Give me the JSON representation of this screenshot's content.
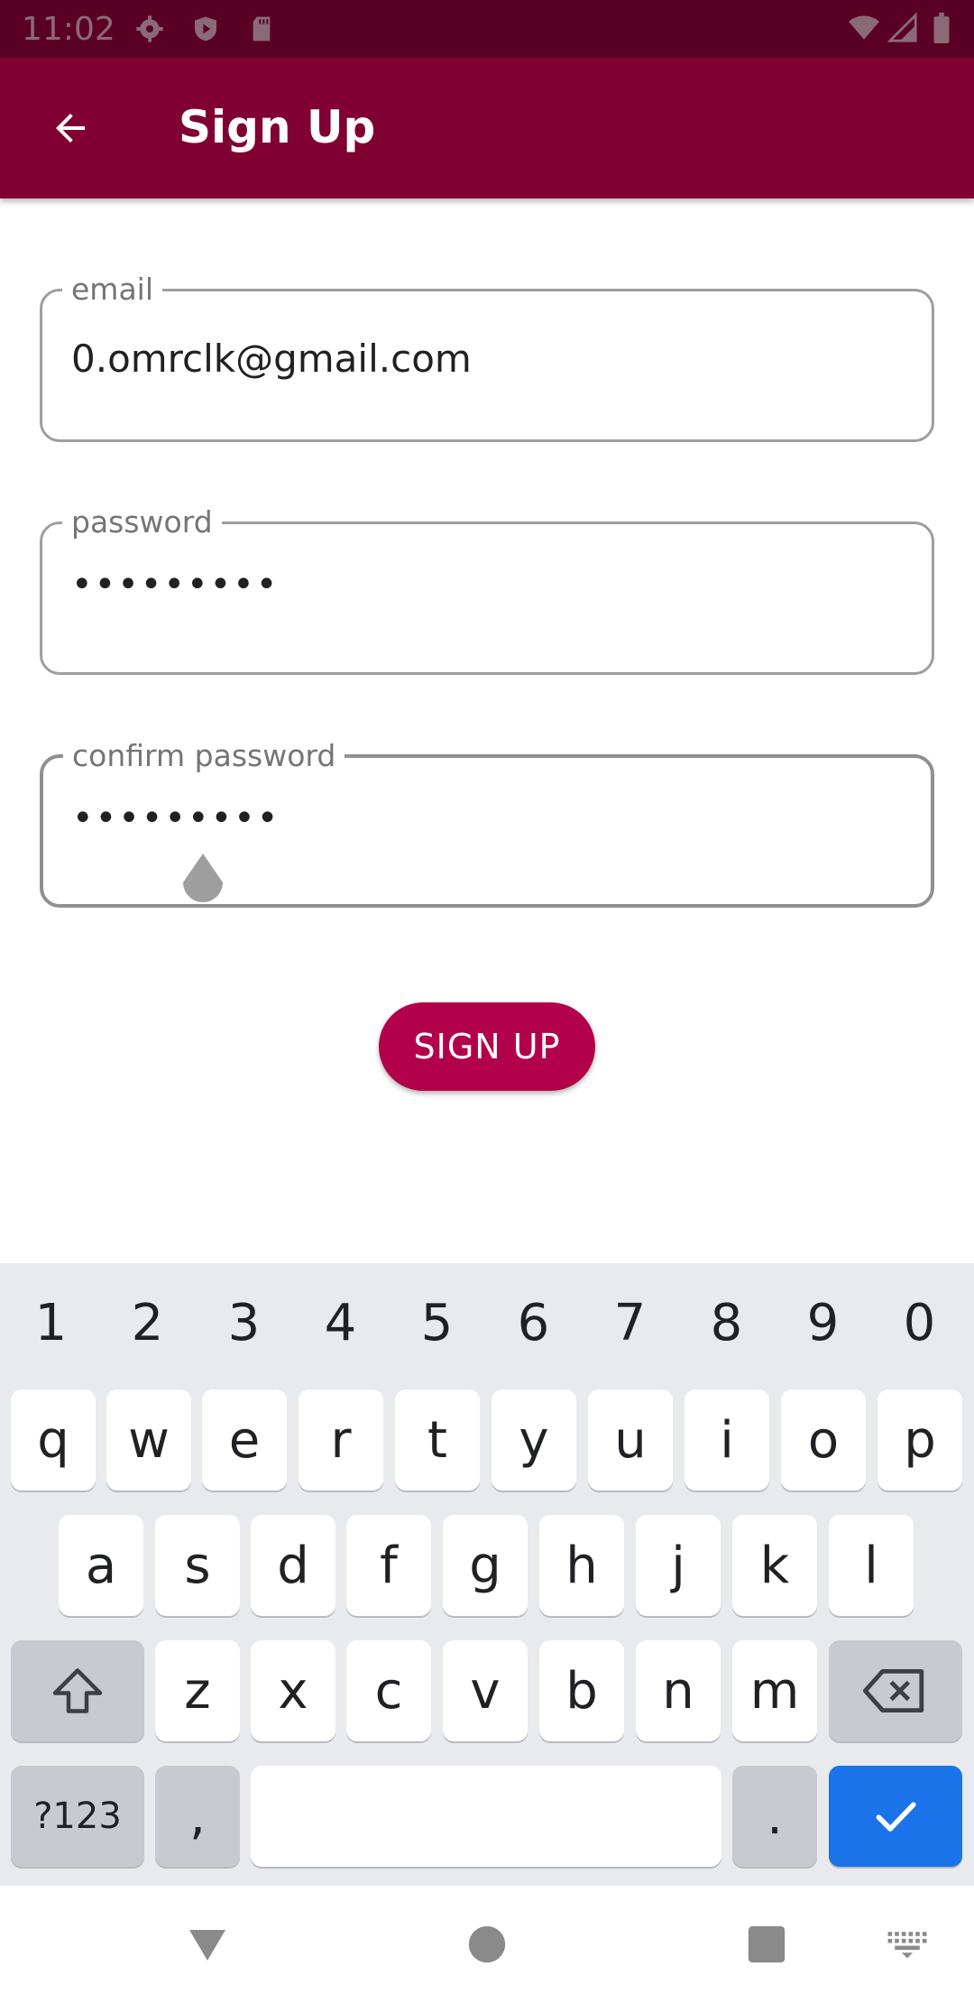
{
  "status_bar": {
    "time": "11:02"
  },
  "app_bar": {
    "title": "Sign Up"
  },
  "form": {
    "email": {
      "label": "email",
      "value": "0.omrclk@gmail.com"
    },
    "password": {
      "label": "password",
      "value": "•••••••••"
    },
    "confirm_password": {
      "label": "confirm password",
      "value": "•••••••••"
    },
    "submit_label": "SIGN UP"
  },
  "keyboard": {
    "number_row": [
      "1",
      "2",
      "3",
      "4",
      "5",
      "6",
      "7",
      "8",
      "9",
      "0"
    ],
    "row1": [
      "q",
      "w",
      "e",
      "r",
      "t",
      "y",
      "u",
      "i",
      "o",
      "p"
    ],
    "row2": [
      "a",
      "s",
      "d",
      "f",
      "g",
      "h",
      "j",
      "k",
      "l"
    ],
    "row3": [
      "z",
      "x",
      "c",
      "v",
      "b",
      "n",
      "m"
    ],
    "symbols_label": "?123",
    "comma_label": ",",
    "period_label": ".",
    "action_icon": "check-icon"
  },
  "colors": {
    "status_bar": "#5b0025",
    "app_bar": "#800033",
    "button": "#b3004a",
    "keyboard_action": "#1a73e8"
  }
}
